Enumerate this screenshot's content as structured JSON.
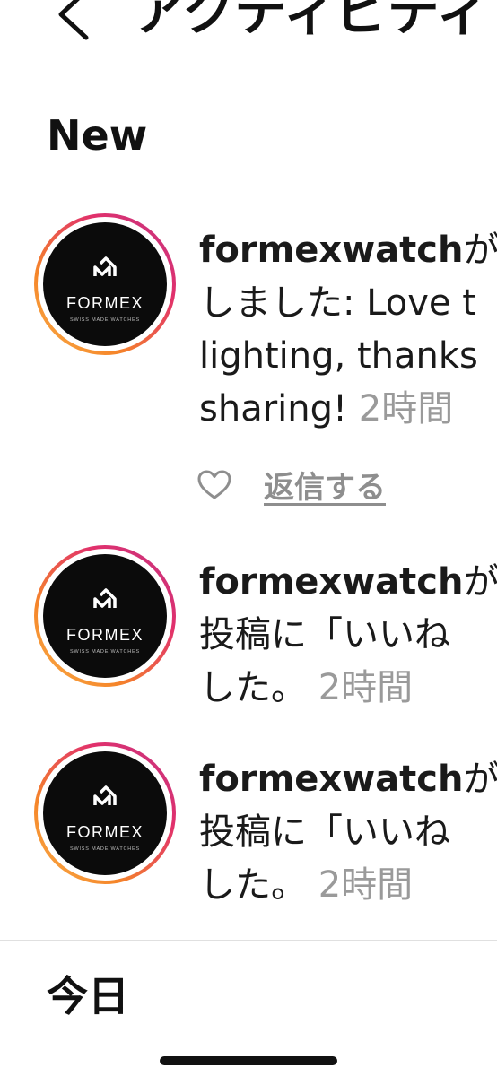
{
  "header": {
    "back_icon": "chevron-left-icon",
    "title": "アクティビティ"
  },
  "sections": {
    "new_title": "New",
    "today_title": "今日"
  },
  "avatar_logo": {
    "brand": "FORMEX",
    "tagline": "SWISS MADE WATCHES"
  },
  "colors": {
    "ring_gradient": [
      "#f9b04a",
      "#f58529",
      "#e1306c",
      "#c13584"
    ],
    "timestamp": "#9a9a9a",
    "reply": "#8e8e8e"
  },
  "items": [
    {
      "username": "formexwatch",
      "line1_tail": "が",
      "line2": "しました: Love t",
      "line3": "lighting, thanks",
      "line4_text": "sharing!",
      "time": "2時間",
      "reply_label": "返信する",
      "like_icon": "heart-outline-icon"
    },
    {
      "username": "formexwatch",
      "line1_tail": "が",
      "line2": "投稿に「いいね",
      "line3_text": "した。",
      "time": "2時間"
    },
    {
      "username": "formexwatch",
      "line1_tail": "が",
      "line2": "投稿に「いいね",
      "line3_text": "した。",
      "time": "2時間"
    }
  ]
}
